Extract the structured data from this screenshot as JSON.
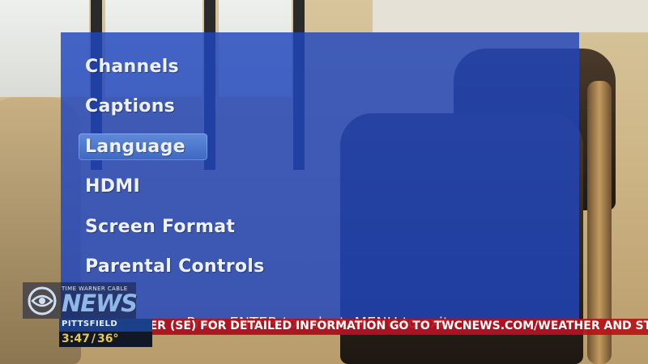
{
  "menu": {
    "items": [
      {
        "label": "Channels",
        "selected": false
      },
      {
        "label": "Captions",
        "selected": false
      },
      {
        "label": "Language",
        "selected": true
      },
      {
        "label": "HDMI",
        "selected": false
      },
      {
        "label": "Screen Format",
        "selected": false
      },
      {
        "label": "Parental Controls",
        "selected": false
      }
    ],
    "hint": "Press ENTER to select, MENU to exit."
  },
  "news": {
    "brand_tag": "TIME WARNER CABLE",
    "logo_text": "NEWS",
    "logo_icon": "eye-icon",
    "location": "PITTSFIELD",
    "time": "3:47",
    "temperature": "36°"
  },
  "ticker": {
    "text": "ARER (SE) FOR DETAILED INFORMATION GO TO TWCNEWS.COM/WEATHER AND STAY"
  },
  "colors": {
    "menu_panel": "#1e46be",
    "menu_selected": "#4f7acd",
    "ticker": "#b90f14",
    "time_text": "#e9c84a",
    "news_logo": "#8fb7e8"
  }
}
